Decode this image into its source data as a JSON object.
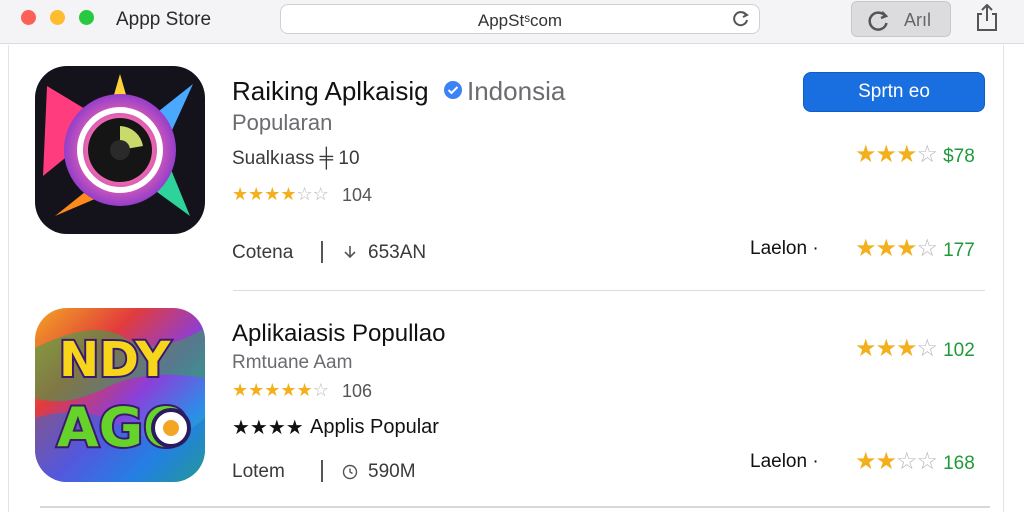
{
  "window": {
    "title": "Appp Store",
    "url": "AppStˢcom",
    "toolbar_button_label": "Arıl",
    "icons": [
      "red-light",
      "yellow-light",
      "green-light",
      "reload-icon",
      "refresh-icon",
      "share-icon"
    ]
  },
  "colors": {
    "accent": "#1a6fe0",
    "star": "#f3b01c",
    "rating_number": "#1f9a3a"
  },
  "apps": [
    {
      "title": "Raiking Aplkaisig",
      "verified_icon": "verified-badge-icon",
      "title_tag": "Indonsia",
      "subtitle": "Popularan",
      "category": "Sualkıass ╪ 10",
      "small_stars_filled": 4,
      "small_stars_total": 6,
      "small_rating_count": "104",
      "developer": "Cotena",
      "size_icon": "download-icon",
      "size": "653AN",
      "action_label": "Sprtn eo",
      "rating1": {
        "stars": 3,
        "total": 4,
        "value": "$78"
      },
      "side_label": "Laelon ·",
      "rating2": {
        "stars": 3,
        "total": 4,
        "value": "177"
      }
    },
    {
      "title": "Aplikaiasis Popullao",
      "logo_text_top": "NDY",
      "logo_text_bottom": "AGO",
      "subtitle": "Rmtuane Aam",
      "small_stars_filled": 5,
      "small_stars_total": 6,
      "small_rating_count": "106",
      "tagline_stars": "★★★★",
      "tagline": "Applis Popular",
      "developer": "Lotem",
      "size_icon": "clock-icon",
      "size": "590M",
      "side_label": "Laelon ·",
      "rating1": {
        "stars": 3,
        "total": 4,
        "value": "102"
      },
      "rating2": {
        "stars": 2,
        "total": 4,
        "value": "168"
      }
    }
  ]
}
